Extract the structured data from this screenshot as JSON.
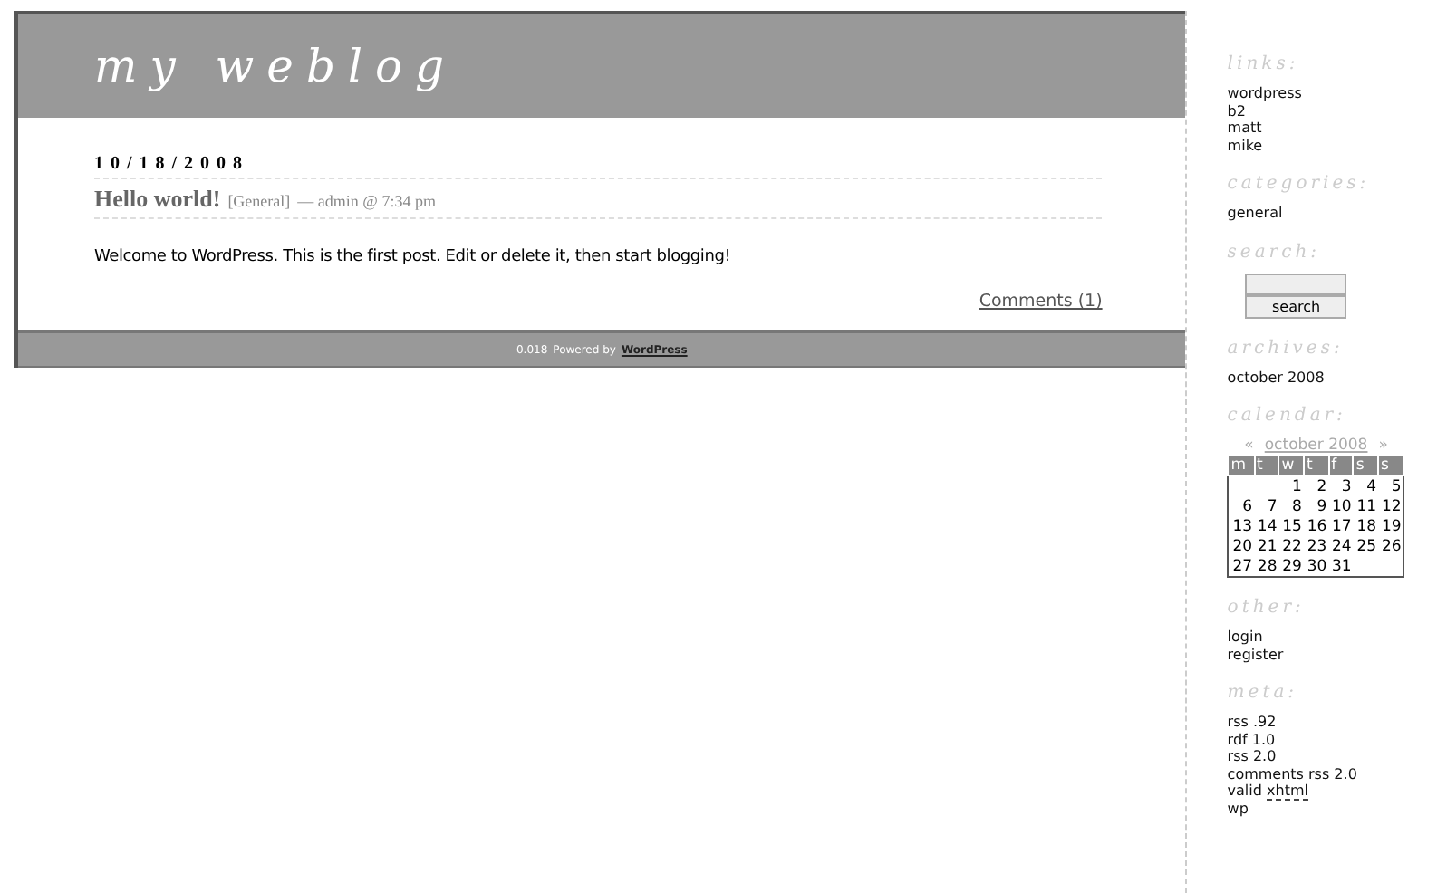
{
  "header": {
    "title": "my weblog"
  },
  "post": {
    "date": "10/18/2008",
    "title": "Hello world!",
    "category": "[General]",
    "meta": "— admin @ 7:34 pm",
    "body": "Welcome to WordPress. This is the first post. Edit or delete it, then start blogging!",
    "comments": "Comments (1)"
  },
  "footer": {
    "version": "0.018",
    "powered": "Powered by",
    "link": "WordPress"
  },
  "sidebar": {
    "links": {
      "heading": "links:",
      "items": [
        "wordpress",
        "b2",
        "matt",
        "mike"
      ]
    },
    "categories": {
      "heading": "categories:",
      "items": [
        "general"
      ]
    },
    "search": {
      "heading": "search:",
      "button": "search"
    },
    "archives": {
      "heading": "archives:",
      "items": [
        "october 2008"
      ]
    },
    "calendar": {
      "heading": "calendar:",
      "prev": "«",
      "month": "october 2008",
      "next": "»",
      "days": [
        "m",
        "t",
        "w",
        "t",
        "f",
        "s",
        "s"
      ],
      "weeks": [
        [
          "1",
          "2",
          "3",
          "4",
          "5"
        ],
        [
          "6",
          "7",
          "8",
          "9",
          "10",
          "11",
          "12"
        ],
        [
          "13",
          "14",
          "15",
          "16",
          "17",
          "18",
          "19"
        ],
        [
          "20",
          "21",
          "22",
          "23",
          "24",
          "25",
          "26"
        ],
        [
          "27",
          "28",
          "29",
          "30",
          "31"
        ]
      ]
    },
    "other": {
      "heading": "other:",
      "items": [
        "login",
        "register"
      ]
    },
    "meta": {
      "heading": "meta:",
      "items": [
        {
          "text": "rss .92"
        },
        {
          "text": "rdf 1.0"
        },
        {
          "text": "rss 2.0"
        },
        {
          "text": "comments rss 2.0"
        },
        {
          "text": "valid",
          "abbr": "xhtml"
        },
        {
          "text": "wp"
        }
      ]
    }
  }
}
